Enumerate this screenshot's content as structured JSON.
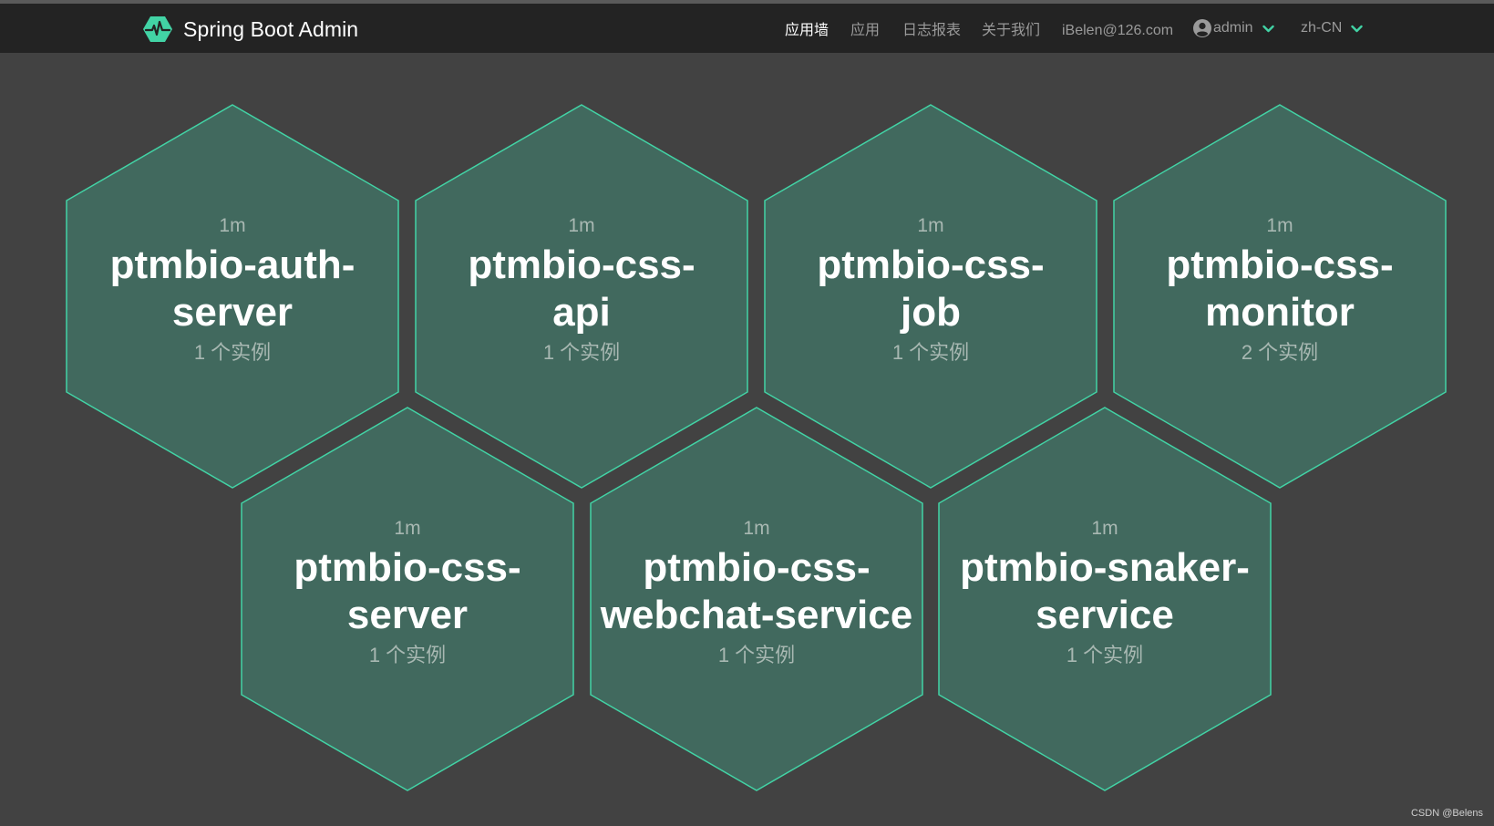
{
  "navbar": {
    "brand": "Spring Boot Admin",
    "items": [
      {
        "label": "应用墙",
        "active": true
      },
      {
        "label": "应用",
        "active": false
      },
      {
        "label": "日志报表",
        "active": false
      },
      {
        "label": "关于我们",
        "active": false
      },
      {
        "label": "iBelen@126.com",
        "active": false
      }
    ],
    "user": "admin",
    "language": "zh-CN"
  },
  "applications": [
    {
      "time": "1m",
      "name_line1": "ptmbio-auth-",
      "name_line2": "server",
      "instances": "1 个实例"
    },
    {
      "time": "1m",
      "name_line1": "ptmbio-css-",
      "name_line2": "api",
      "instances": "1 个实例"
    },
    {
      "time": "1m",
      "name_line1": "ptmbio-css-",
      "name_line2": "job",
      "instances": "1 个实例"
    },
    {
      "time": "1m",
      "name_line1": "ptmbio-css-",
      "name_line2": "monitor",
      "instances": "2 个实例"
    },
    {
      "time": "1m",
      "name_line1": "ptmbio-css-",
      "name_line2": "server",
      "instances": "1 个实例"
    },
    {
      "time": "1m",
      "name_line1": "ptmbio-css-",
      "name_line2": "webchat-service",
      "instances": "1 个实例"
    },
    {
      "time": "1m",
      "name_line1": "ptmbio-snaker-",
      "name_line2": "service",
      "instances": "1 个实例"
    }
  ],
  "watermark": "CSDN @Belens",
  "colors": {
    "hex_fill": "#41695e",
    "hex_stroke": "#42d3a5",
    "accent": "#42d3a5",
    "background": "#424242",
    "navbar": "#232323"
  }
}
